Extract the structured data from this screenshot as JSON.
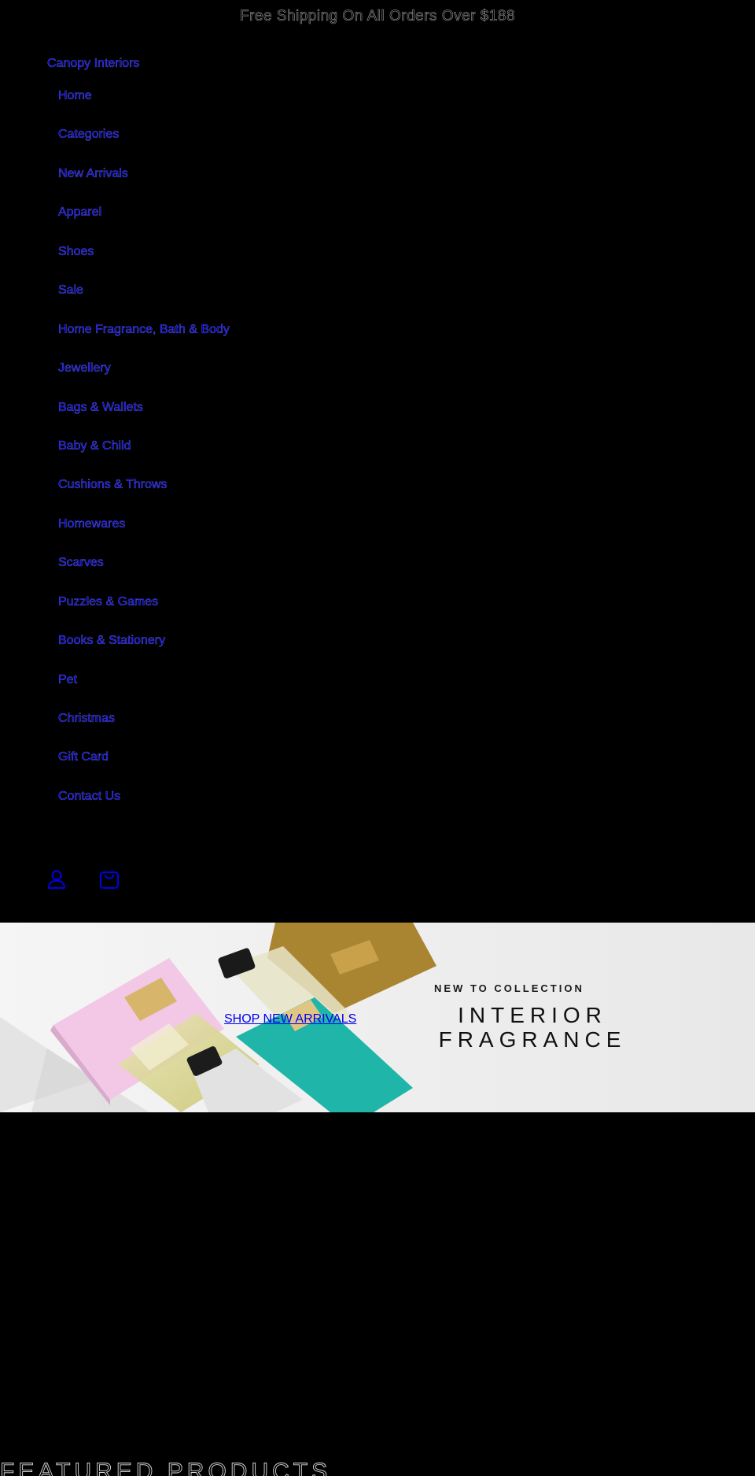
{
  "announcement": "Free Shipping On All Orders Over $188",
  "brand": "Canopy Interiors",
  "nav": [
    "Home",
    "Categories",
    "New Arrivals",
    "Apparel",
    "Shoes",
    "Sale",
    "Home Fragrance, Bath & Body",
    "Jewellery",
    "Bags & Wallets",
    "Baby & Child",
    "Cushions & Throws",
    "Homewares",
    "Scarves",
    "Puzzles & Games",
    "Books & Stationery",
    "Pet",
    "Christmas",
    "Gift Card",
    "Contact Us"
  ],
  "icons": {
    "account": "person-icon",
    "cart": "shopping-bag-icon"
  },
  "hero": {
    "cta": "SHOP NEW ARRIVALS",
    "kicker": "NEW TO COLLECTION",
    "title_line1": "INTERIOR",
    "title_line2": "FRAGRANCE"
  },
  "section_heading": "FEATURED PRODUCTS",
  "colors": {
    "background": "#000000",
    "link": "#0000ee",
    "box_pink": "#f2c8e6",
    "box_teal": "#1fb5a8",
    "box_gold": "#a98531"
  }
}
